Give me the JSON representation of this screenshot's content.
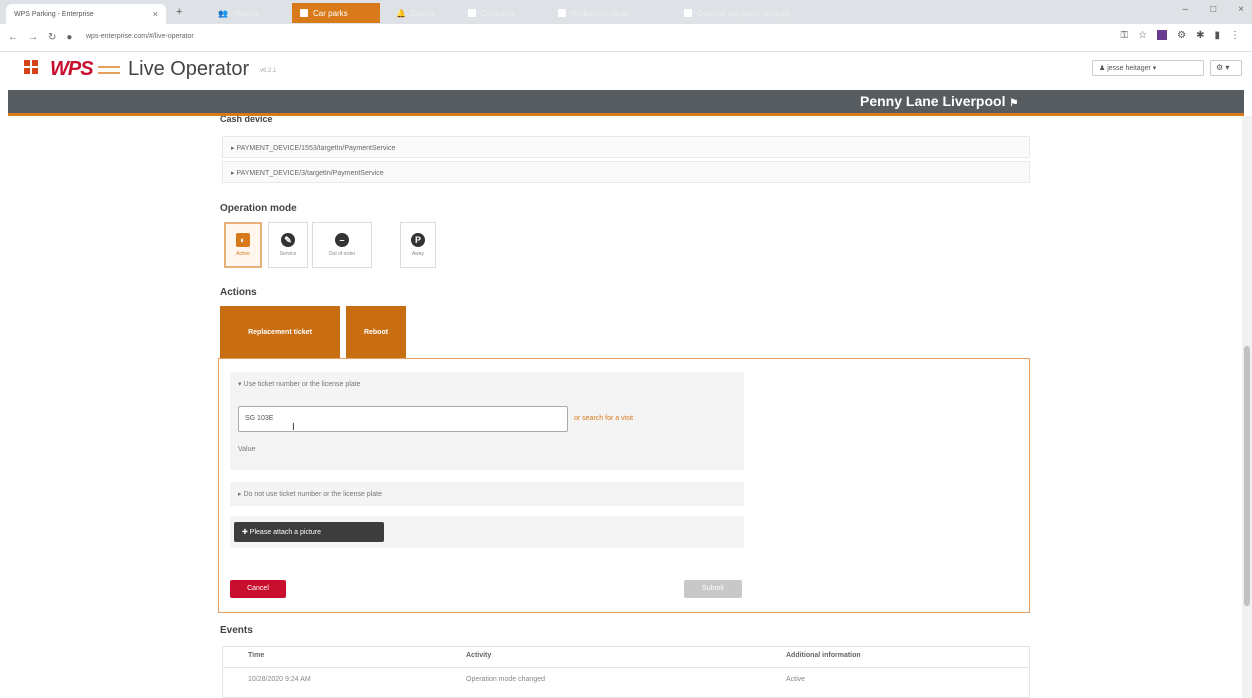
{
  "browser": {
    "tab_title": "WPS Parking - Enterprise",
    "close_tab": "×",
    "new_tab": "+",
    "url": "wps-enterprise.com/#/live-operator",
    "window_controls": [
      "–",
      "□",
      "×"
    ]
  },
  "app": {
    "logo_text": "WPS",
    "title": "Live Operator",
    "subtitle": "v6.2.1",
    "user": "jesse heitager",
    "user_caret": "▾",
    "settings_label": "⚙ ▾"
  },
  "nav": {
    "items": [
      {
        "label": "Visitors",
        "active": false
      },
      {
        "label": "Car parks",
        "active": true
      },
      {
        "label": "Events",
        "active": false
      },
      {
        "label": "Contracts",
        "active": false
      },
      {
        "label": "Reduction cards",
        "active": false
      },
      {
        "label": "General car parks settings",
        "active": false
      }
    ],
    "site_name": "Penny Lane Liverpool",
    "site_icon": "bell-icon"
  },
  "content": {
    "cash_device_heading": "Cash device",
    "devices": [
      "PAYMENT_DEVICE/1553/targetIn/PaymentService",
      "PAYMENT_DEVICE/3/targetIn/PaymentService"
    ],
    "operation_mode_heading": "Operation mode",
    "modes": [
      {
        "label": "Active",
        "glyph": "◐",
        "active": true
      },
      {
        "label": "Service",
        "glyph": "✎",
        "active": false
      },
      {
        "label": "Out of order",
        "glyph": "–",
        "active": false
      },
      {
        "label": "Away",
        "glyph": "P",
        "active": false
      }
    ],
    "actions_heading": "Actions",
    "actions": [
      "Replacement ticket",
      "Reboot"
    ],
    "accordion1_label": "▾ Use ticket number or the license plate",
    "input_value": "SG 103E",
    "search_link": "or search for a visit",
    "value_label": "Value",
    "accordion2_label": "▸ Do not use ticket number or the license plate",
    "attach_label": "✚ Please attach a picture",
    "cancel_label": "Cancel",
    "submit_label": "Submit"
  },
  "events": {
    "heading": "Events",
    "columns": [
      "Time",
      "Activity",
      "Additional information"
    ],
    "rows": [
      [
        "10/28/2020 9:24 AM",
        "Operation mode changed",
        "Active"
      ]
    ]
  }
}
